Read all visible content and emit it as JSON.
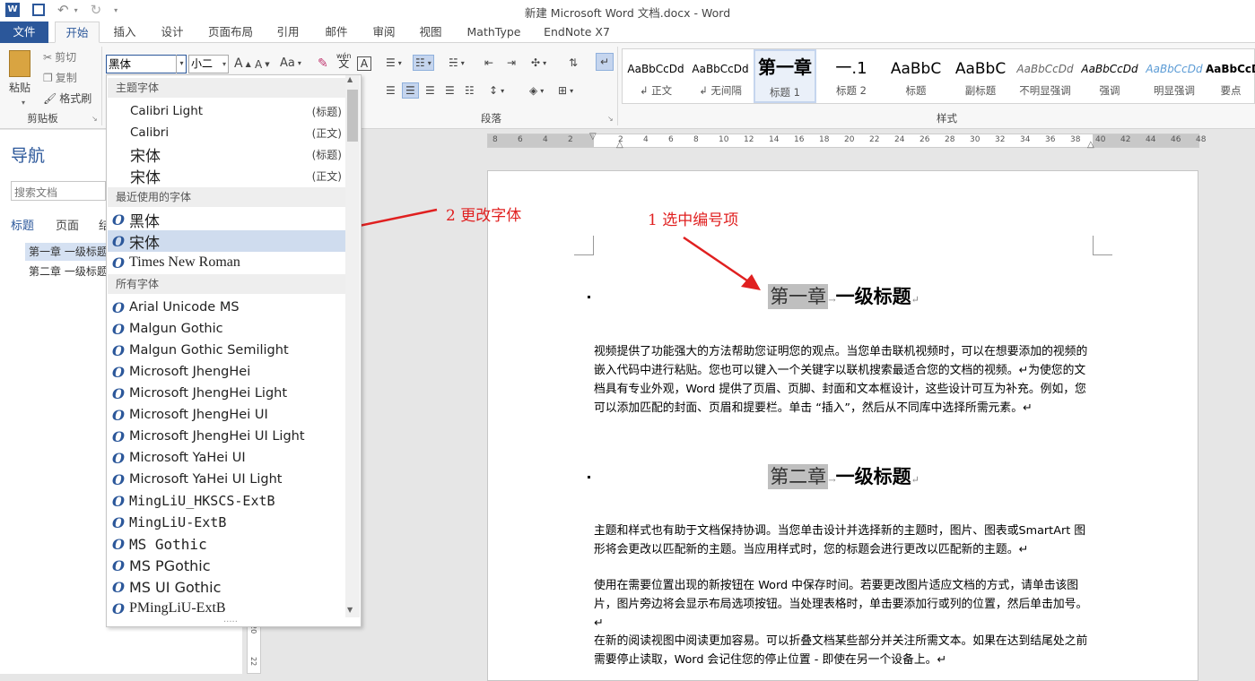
{
  "window": {
    "title": "新建 Microsoft Word 文档.docx - Word"
  },
  "tabs": [
    "文件",
    "开始",
    "插入",
    "设计",
    "页面布局",
    "引用",
    "邮件",
    "审阅",
    "视图",
    "MathType",
    "EndNote X7"
  ],
  "clipboard": {
    "paste": "粘贴",
    "cut": "剪切",
    "copy": "复制",
    "format_painter": "格式刷",
    "group": "剪贴板"
  },
  "font": {
    "name": "黑体",
    "size": "小二",
    "change_case": "Aa",
    "wen_top": "wén",
    "wen_bottom": "文",
    "border_char": "A"
  },
  "paragraph": {
    "group": "段落"
  },
  "styles": {
    "group": "样式",
    "items": [
      {
        "sample": "AaBbCcDd",
        "name": "↲ 正文"
      },
      {
        "sample": "AaBbCcDd",
        "name": "↲ 无间隔"
      },
      {
        "sample": "第一章",
        "name": "标题 1"
      },
      {
        "sample": "一.1",
        "name": "标题 2"
      },
      {
        "sample": "AaBbC",
        "name": "标题"
      },
      {
        "sample": "AaBbC",
        "name": "副标题"
      },
      {
        "sample": "AaBbCcDd",
        "name": "不明显强调"
      },
      {
        "sample": "AaBbCcDd",
        "name": "强调"
      },
      {
        "sample": "AaBbCcDd",
        "name": "明显强调"
      },
      {
        "sample": "AaBbCcD",
        "name": "要点"
      }
    ]
  },
  "navigation": {
    "title": "导航",
    "search_placeholder": "搜索文档",
    "tabs": [
      "标题",
      "页面",
      "结"
    ],
    "headings": [
      "第一章 一级标题",
      "第二章 一级标题"
    ]
  },
  "ruler": {
    "labels": [
      "8",
      "6",
      "4",
      "2",
      "",
      "2",
      "4",
      "6",
      "8",
      "10",
      "12",
      "14",
      "16",
      "18",
      "20",
      "22",
      "24",
      "26",
      "28",
      "30",
      "32",
      "34",
      "36",
      "38",
      "40",
      "42",
      "44",
      "46",
      "48"
    ]
  },
  "vruler": {
    "labels": [
      "20",
      "22"
    ]
  },
  "font_dropdown": {
    "theme_header": "主题字体",
    "theme": [
      {
        "name": "Calibri Light",
        "tag": "(标题)"
      },
      {
        "name": "Calibri",
        "tag": "(正文)"
      },
      {
        "name": "宋体",
        "tag": "(标题)"
      },
      {
        "name": "宋体",
        "tag": "(正文)"
      }
    ],
    "recent_header": "最近使用的字体",
    "recent": [
      "黑体",
      "宋体",
      "Times New Roman"
    ],
    "all_header": "所有字体",
    "all": [
      "Arial Unicode MS",
      "Malgun Gothic",
      "Malgun Gothic Semilight",
      "Microsoft JhengHei",
      "Microsoft JhengHei Light",
      "Microsoft JhengHei UI",
      "Microsoft JhengHei UI Light",
      "Microsoft YaHei UI",
      "Microsoft YaHei UI Light",
      "MingLiU_HKSCS-ExtB",
      "MingLiU-ExtB",
      "MS Gothic",
      "MS PGothic",
      "MS UI Gothic",
      "PMingLiU-ExtB"
    ],
    "resize_grip": "....."
  },
  "annotations": {
    "step1": "1 选中编号项",
    "step2": "2 更改字体"
  },
  "document": {
    "h1_num": "第一章",
    "h1_text": "一级标题",
    "para1": "视频提供了功能强大的方法帮助您证明您的观点。当您单击联机视频时，可以在想要添加的视频的嵌入代码中进行粘贴。您也可以键入一个关键字以联机搜索最适合您的文档的视频。↵为使您的文档具有专业外观，Word 提供了页眉、页脚、封面和文本框设计，这些设计可互为补充。例如，您可以添加匹配的封面、页眉和提要栏。单击 “插入”，然后从不同库中选择所需元素。↵",
    "h2_num": "第二章",
    "h2_text": "一级标题",
    "para2": "主题和样式也有助于文档保持协调。当您单击设计并选择新的主题时，图片、图表或SmartArt 图形将会更改以匹配新的主题。当应用样式时，您的标题会进行更改以匹配新的主题。↵",
    "para3": "使用在需要位置出现的新按钮在 Word 中保存时间。若要更改图片适应文档的方式，请单击该图片，图片旁边将会显示布局选项按钮。当处理表格时，单击要添加行或列的位置，然后单击加号。↵",
    "para4": "在新的阅读视图中阅读更加容易。可以折叠文档某些部分并关注所需文本。如果在达到结尾处之前需要停止读取，Word 会记住您的停止位置 - 即使在另一个设备上。↵"
  }
}
